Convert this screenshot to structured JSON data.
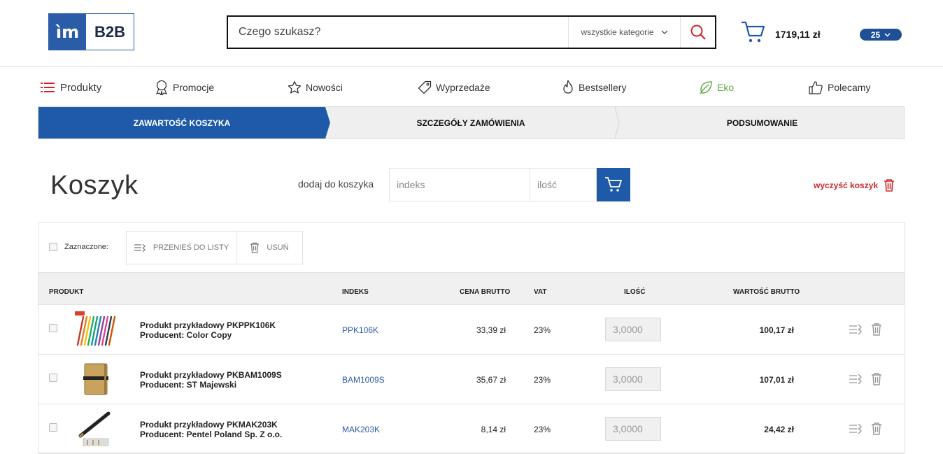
{
  "header": {
    "logo_mark": "ìm",
    "logo_text": "B2B",
    "search_placeholder": "Czego szukasz?",
    "category_label": "wszystkie kategorie",
    "cart_total": "1719,11 zł",
    "cart_badge": "25"
  },
  "nav": {
    "items": [
      {
        "label": "Produkty",
        "icon": "list-icon"
      },
      {
        "label": "Promocje",
        "icon": "award-icon"
      },
      {
        "label": "Nowości",
        "icon": "star-icon"
      },
      {
        "label": "Wyprzedaże",
        "icon": "tag-icon"
      },
      {
        "label": "Bestsellery",
        "icon": "flame-icon"
      },
      {
        "label": "Eko",
        "icon": "leaf-icon"
      },
      {
        "label": "Polecamy",
        "icon": "thumbs-up-icon"
      }
    ]
  },
  "steps": [
    "ZAWARTOŚĆ KOSZYKA",
    "SZCZEGÓŁY ZAMÓWIENIA",
    "PODSUMOWANIE"
  ],
  "cart": {
    "title": "Koszyk",
    "add_label": "dodaj do koszyka",
    "index_placeholder": "indeks",
    "qty_placeholder": "ilość",
    "clear_label": "wyczyść koszyk"
  },
  "toolbar": {
    "selected_label": "Zaznaczone:",
    "move_label": "PRZENIEŚ DO LISTY",
    "delete_label": "USUŃ"
  },
  "table": {
    "headers": [
      "PRODUKT",
      "INDEKS",
      "CENA BRUTTO",
      "VAT",
      "ILOŚĆ",
      "WARTOŚĆ BRUTTO"
    ],
    "rows": [
      {
        "name": "Produkt przykładowy PKPPK106K",
        "producer": "Producent: Color Copy",
        "index": "PPK106K",
        "price": "33,39 zł",
        "vat": "23%",
        "qty": "3,0000",
        "total": "100,17 zł"
      },
      {
        "name": "Produkt przykładowy PKBAM1009S",
        "producer": "Producent: ST Majewski",
        "index": "BAM1009S",
        "price": "35,67 zł",
        "vat": "23%",
        "qty": "3,0000",
        "total": "107,01 zł"
      },
      {
        "name": "Produkt przykładowy PKMAK203K",
        "producer": "Producent: Pentel Poland Sp. Z o.o.",
        "index": "MAK203K",
        "price": "8,14 zł",
        "vat": "23%",
        "qty": "3,0000",
        "total": "24,42 zł"
      }
    ]
  },
  "colors": {
    "brand_blue": "#1f5aa8",
    "accent_red": "#d0262a",
    "eko_green": "#5ea93f"
  }
}
